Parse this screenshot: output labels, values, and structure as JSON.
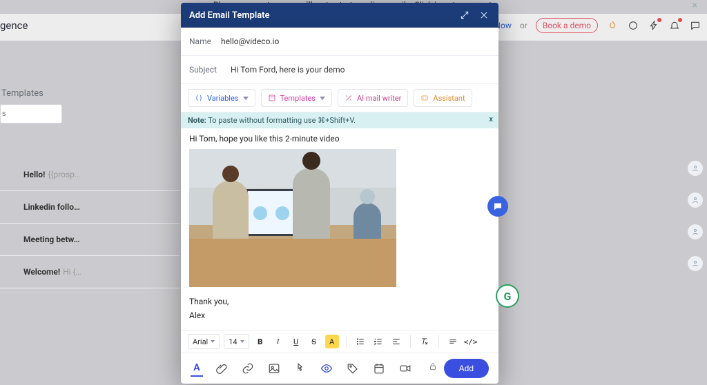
{
  "banner": {
    "prefix": "Please connect your ",
    "bold": "emailbox",
    "middle": " to start sending emails. Click ",
    "link": "here",
    "suffix": " to connect."
  },
  "header": {
    "brand_fragment": "gence",
    "upgrade": "Upgrade Now",
    "or": "or",
    "demo": "Book a demo"
  },
  "sidebar": {
    "section": "Templates",
    "search_placeholder": "s",
    "rows": [
      {
        "bold": "Hello!",
        "rest": "{{prosp…"
      },
      {
        "bold": "Linkedin follo…",
        "rest": ""
      },
      {
        "bold": "Meeting betw…",
        "rest": ""
      },
      {
        "bold": "Welcome!",
        "rest": "Hi {…"
      }
    ]
  },
  "modal": {
    "title": "Add Email Template",
    "name_label": "Name",
    "name_value": "hello@videco.io",
    "subject_label": "Subject",
    "subject_value": "Hi Tom Ford, here is your demo",
    "tool_variables": "Variables",
    "tool_templates": "Templates",
    "tool_ai": "AI mail writer",
    "tool_assistant": "Assistant",
    "note_bold": "Note:",
    "note_text": "To paste without formatting use ⌘+Shift+V.",
    "body_line": "Hi Tom, hope you like this 2-minute video",
    "signoff1": "Thank you,",
    "signoff2": "Alex",
    "font_name": "Arial",
    "font_size": "14",
    "add_button": "Add"
  }
}
